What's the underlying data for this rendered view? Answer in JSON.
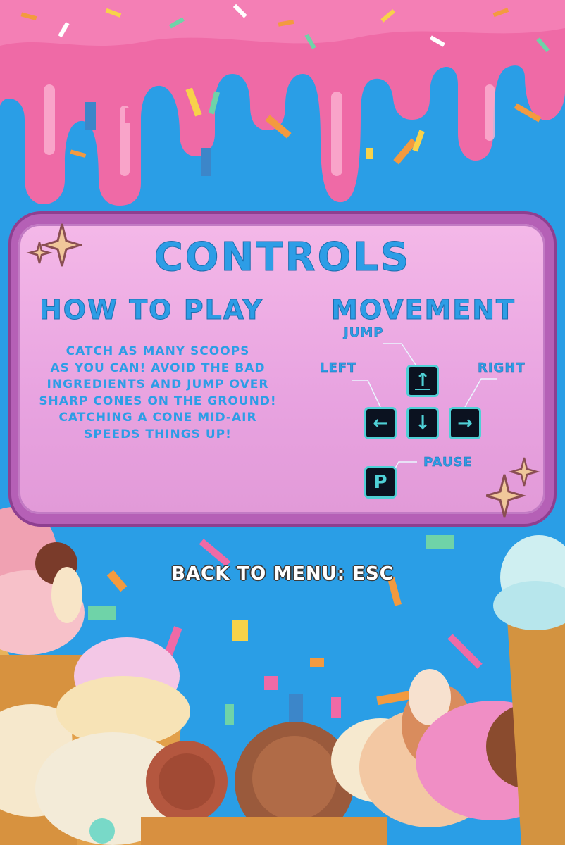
{
  "screen": {
    "title": "CONTROLS",
    "how_to_play": {
      "heading": "HOW TO PLAY",
      "lines": [
        "CATCH AS MANY SCOOPS",
        "AS YOU CAN! AVOID THE BAD",
        "INGREDIENTS AND JUMP OVER",
        "SHARP CONES ON THE GROUND!",
        "CATCHING A CONE MID-AIR",
        "SPEEDS THINGS UP!"
      ]
    },
    "movement": {
      "heading": "MOVEMENT",
      "jump_label": "JUMP",
      "left_label": "LEFT",
      "right_label": "RIGHT",
      "pause_label": "PAUSE",
      "keys": {
        "up": "↑",
        "left": "←",
        "down": "↓",
        "right": "→",
        "pause": "P"
      }
    },
    "back_to_menu": "BACK TO MENU: ESC"
  },
  "colors": {
    "background": "#2a9ee6",
    "drip": "#ef6aa6",
    "panel_border": "#b560b6",
    "panel_fill": "#f4b8e8",
    "heading": "#2d9de6",
    "key_fill": "#0b1220",
    "key_accent": "#4fd0d6"
  },
  "icons": [
    "sparkle-icon",
    "arrow-up-icon",
    "arrow-left-icon",
    "arrow-down-icon",
    "arrow-right-icon"
  ]
}
